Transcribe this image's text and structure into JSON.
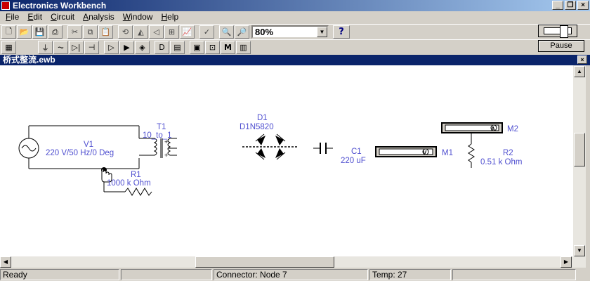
{
  "window": {
    "title": "Electronics Workbench"
  },
  "menu": [
    {
      "label": "File",
      "key": "F",
      "rest": "ile"
    },
    {
      "label": "Edit",
      "key": "E",
      "rest": "dit"
    },
    {
      "label": "Circuit",
      "key": "C",
      "rest": "ircuit"
    },
    {
      "label": "Analysis",
      "key": "A",
      "rest": "nalysis"
    },
    {
      "label": "Window",
      "key": "W",
      "rest": "indow"
    },
    {
      "label": "Help",
      "key": "H",
      "rest": "elp"
    }
  ],
  "toolbar": {
    "zoom": "80%",
    "help": "?"
  },
  "toolbar2": {
    "meter": "M"
  },
  "simulation": {
    "pause_label": "Pause"
  },
  "document": {
    "title": "桥式整流.ewb"
  },
  "circuit": {
    "v1": {
      "name": "V1",
      "value": "220 V/50 Hz/0 Deg"
    },
    "t1": {
      "name": "T1",
      "value": "10_to_1"
    },
    "r1": {
      "name": "R1",
      "value": "1000 k Ohm"
    },
    "d1": {
      "name": "D1",
      "value": "D1N5820"
    },
    "c1": {
      "name": "C1",
      "value": "220 uF"
    },
    "m1": {
      "name": "M1",
      "mode": "V"
    },
    "m2": {
      "name": "M2",
      "mode": "A"
    },
    "r2": {
      "name": "R2",
      "value": "0.51 k Ohm"
    }
  },
  "status": {
    "ready": "Ready",
    "connector": "Connector: Node 7",
    "temp": "Temp:  27"
  }
}
